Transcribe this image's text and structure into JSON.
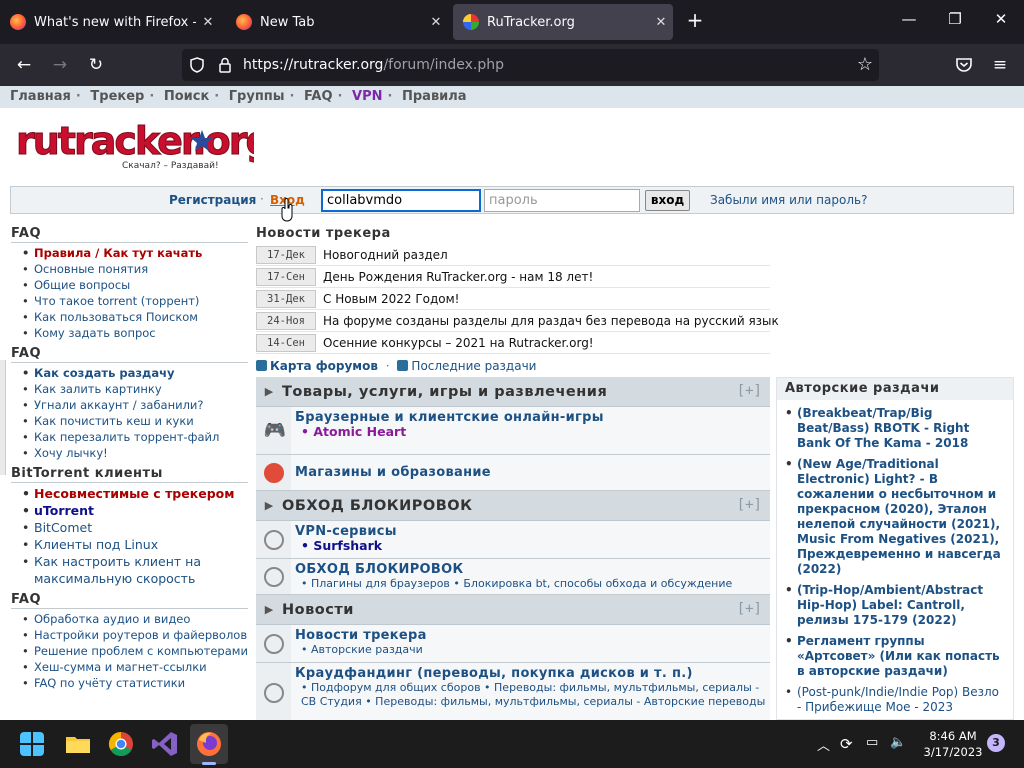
{
  "browser": {
    "tabs": [
      {
        "title": "What's new with Firefox - More",
        "close": "✕"
      },
      {
        "title": "New Tab",
        "close": "✕"
      },
      {
        "title": "RuTracker.org",
        "close": "✕"
      }
    ],
    "new_tab": "+",
    "window_controls": {
      "minimize": "—",
      "maximize": "❐",
      "close": "✕"
    },
    "url_host": "https://rutracker.org",
    "url_path": "/forum/index.php"
  },
  "topmenu": [
    "Главная",
    "Трекер",
    "Поиск",
    "Группы",
    "FAQ",
    "VPN",
    "Правила"
  ],
  "logo": {
    "text": "rutracker.org",
    "slogan": "Скачал? – Раздавай!"
  },
  "login": {
    "register": "Регистрация",
    "dot": "·",
    "login_link": "Вход",
    "username_value": "collabvmdo",
    "password_placeholder": "пароль",
    "submit": "вход",
    "forgot": "Забыли имя или пароль?"
  },
  "sidebar": {
    "sections": [
      {
        "title": "FAQ",
        "items": [
          "Правила / Как тут качать",
          "Основные понятия",
          "Общие вопросы",
          "Что такое torrent (торрент)",
          "Как пользоваться Поиском",
          "Кому задать вопрос"
        ]
      },
      {
        "title": "FAQ",
        "items": [
          "Как создать раздачу",
          "Как залить картинку",
          "Угнали аккаунт / забанили?",
          "Как почистить кеш и куки",
          "Как перезалить торрент-файл",
          "Хочу лычку!"
        ]
      },
      {
        "title": "BitTorrent клиенты",
        "items": [
          "Несовместимые с трекером",
          "uTorrent",
          "BitComet",
          "Клиенты под Linux",
          "Как настроить клиент на максимальную скорость"
        ]
      },
      {
        "title": "FAQ",
        "items": [
          "Обработка аудио и видео",
          "Настройки роутеров и файерволов",
          "Решение проблем с компьютерами",
          "Хеш-сумма и магнет-ссылки",
          "FAQ по учёту статистики"
        ]
      }
    ]
  },
  "news": {
    "title": "Новости трекера",
    "items": [
      {
        "date": "17-Дек",
        "text": "Новогодний раздел"
      },
      {
        "date": "17-Сен",
        "text": "День Рождения RuTracker.org - нам 18 лет!"
      },
      {
        "date": "31-Дек",
        "text": "С Новым 2022 Годом!"
      },
      {
        "date": "24-Ноя",
        "text": "На форуме созданы разделы для раздач без перевода на русский язык"
      },
      {
        "date": "14-Сен",
        "text": "Осенние конкурсы – 2021 на Rutracker.org!"
      }
    ]
  },
  "links": {
    "forum_map": "Карта форумов",
    "latest": "Последние раздачи"
  },
  "forum": {
    "cat1": {
      "title": "Товары, услуги, игры и развлечения",
      "plus": "[+]"
    },
    "f1": {
      "name": "Браузерные и клиентские онлайн-игры",
      "sub": "• Atomic Heart"
    },
    "f2": {
      "name": "Магазины и образование"
    },
    "cat2": {
      "title": "ОБХОД БЛОКИРОВОК",
      "plus": "[+]"
    },
    "f3": {
      "name": "VPN-сервисы",
      "sub": "• Surfshark"
    },
    "f4": {
      "name": "ОБХОД БЛОКИРОВОК",
      "sub": "• Плагины для браузеров • Блокировка bt, способы обхода и обсуждение"
    },
    "cat3": {
      "title": "Новости",
      "plus": "[+]"
    },
    "f5": {
      "name": "Новости трекера",
      "sub": "• Авторские раздачи"
    },
    "f6": {
      "name": "Краудфандинг (переводы, покупка дисков и т. п.)",
      "sub": "• Подфорум для общих сборов • Переводы: фильмы, мультфильмы, сериалы - СВ Студия • Переводы: фильмы, мультфильмы, сериалы - Авторские переводы"
    }
  },
  "author_releases": {
    "title": "Авторские раздачи",
    "items": [
      "(Breakbeat/Trap/Big Beat/Bass) RBOTK - Right Bank Of The Kama - 2018",
      "(New Age/Traditional Electronic) Light? - В сожалении о несбыточном и прекрасном (2020), Эталон нелепой случайности (2021), Music From Negatives (2021), Преждевременно и навсегда (2022)",
      "(Trip-Hop/Ambient/Abstract Hip-Hop) Label: Cantroll, релизы 175-179 (2022)",
      "Регламент группы «Артсовет» (Или как попасть в авторские раздачи)",
      "(Post-punk/Indie/Indie Pop) Везло - Прибежище Мое - 2023"
    ]
  },
  "taskbar": {
    "time": "8:46 AM",
    "date": "3/17/2023",
    "notifications": "3"
  }
}
